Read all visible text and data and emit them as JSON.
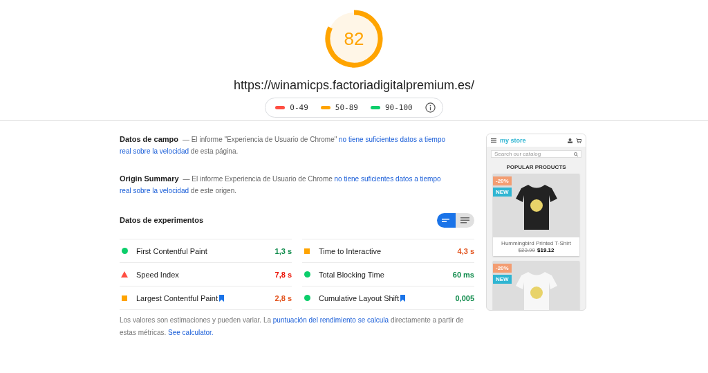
{
  "gauge": {
    "score": "82",
    "level": 0.82
  },
  "url": "https://winamicps.factoriadigitalpremium.es/",
  "legend": [
    {
      "label": "0-49",
      "color": "#ff4e42"
    },
    {
      "label": "50-89",
      "color": "#ffa400"
    },
    {
      "label": "90-100",
      "color": "#0cce6b"
    }
  ],
  "field_sections": [
    {
      "title": "Datos de campo",
      "text": "— El informe \"Experiencia de Usuario de Chrome\" ",
      "link": [
        "no tiene suficientes datos a tiempo",
        "real sobre la velocidad"
      ],
      "tail": " de esta página."
    },
    {
      "title": "Origin Summary",
      "text": "— El informe Experiencia de Usuario de Chrome ",
      "link": [
        "no tiene suficientes datos a tiempo",
        "real sobre la velocidad"
      ],
      "tail": " de este origen."
    }
  ],
  "lab": {
    "title": "Datos de experimentos",
    "view_toggle": [
      {
        "selected": true
      },
      {
        "selected": false
      }
    ],
    "metrics": [
      {
        "label": "First Contentful Paint",
        "value": "1,3 s",
        "kind": "pass",
        "bookmark": false
      },
      {
        "label": "Time to Interactive",
        "value": "4,3 s",
        "kind": "average",
        "bookmark": false
      },
      {
        "label": "Speed Index",
        "value": "7,8 s",
        "kind": "fail",
        "bookmark": false
      },
      {
        "label": "Total Blocking Time",
        "value": "60 ms",
        "kind": "pass",
        "bookmark": false
      },
      {
        "label": "Largest Contentful Paint",
        "value": "2,8 s",
        "kind": "average",
        "bookmark": true
      },
      {
        "label": "Cumulative Layout Shift",
        "value": "0,005",
        "kind": "pass",
        "bookmark": true
      }
    ],
    "note": "Los valores son estimaciones y pueden variar. La ",
    "note_link": "puntuación del rendimiento se calcula",
    "note_mid": " directamente a partir de estas métricas. ",
    "note_link2": "See calculator."
  },
  "preview": {
    "logo": "my store",
    "search_placeholder": "Search our catalog",
    "heading": "POPULAR PRODUCTS",
    "products": [
      {
        "discount": "-20%",
        "flag": "NEW",
        "name": "Hummingbird Printed T-Shirt",
        "old_price": "$23.90",
        "price": "$19.12",
        "kind": "dark"
      },
      {
        "discount": "-20%",
        "flag": "NEW",
        "kind": "light"
      }
    ]
  }
}
